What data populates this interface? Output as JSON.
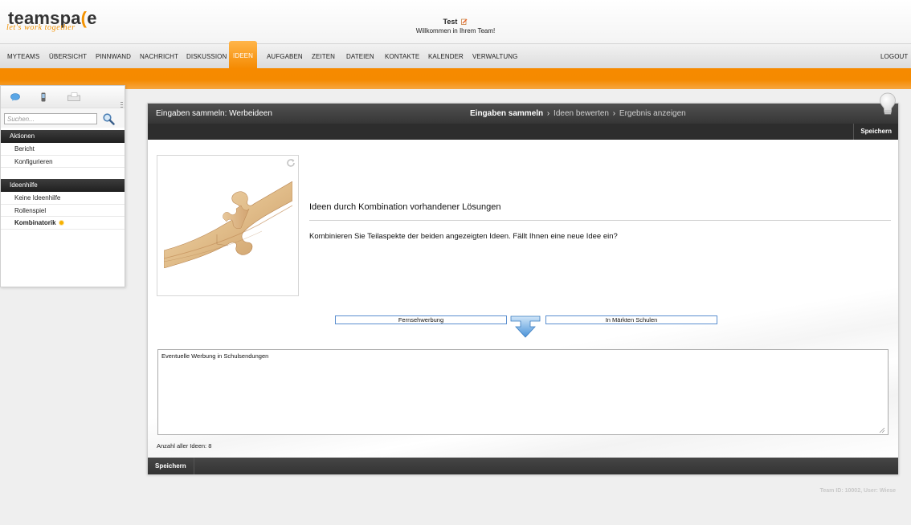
{
  "brand": {
    "name_prefix": "teamspa",
    "name_suffix": "e",
    "tagline": "let's work together",
    "accent_color": "#f58a00"
  },
  "greeting": {
    "user": "Test",
    "message": "Willkommen in Ihrem Team!"
  },
  "nav": {
    "items": [
      "MYTEAMS",
      "ÜBERSICHT",
      "PINNWAND",
      "NACHRICHT",
      "DISKUSSION",
      "IDEEN",
      "AUFGABEN",
      "ZEITEN",
      "DATEIEN",
      "KONTAKTE",
      "KALENDER",
      "VERWALTUNG"
    ],
    "active": "IDEEN",
    "logout": "LOGOUT"
  },
  "sidebar": {
    "search_placeholder": "Suchen...",
    "sections": [
      {
        "title": "Aktionen",
        "items": [
          {
            "label": "Bericht"
          },
          {
            "label": "Konfigurieren"
          }
        ]
      },
      {
        "title": "Ideenhilfe",
        "items": [
          {
            "label": "Keine Ideenhilfe"
          },
          {
            "label": "Rollenspiel"
          },
          {
            "label": "Kombinatorik",
            "active": true
          }
        ]
      }
    ]
  },
  "panel": {
    "title": "Eingaben sammeln: Werbeideen",
    "steps": [
      "Eingaben sammeln",
      "Ideen bewerten",
      "Ergebnis anzeigen"
    ],
    "current_step": "Eingaben sammeln",
    "save_label": "Speichern",
    "idea_title": "Ideen durch Kombination vorhandener Lösungen",
    "idea_description": "Kombinieren Sie Teilaspekte der beiden angezeigten Ideen. Fällt Ihnen eine neue Idee ein?",
    "combo_left": "Fernsehwerbung",
    "combo_right": "In Märkten Schulen",
    "textarea_value": "Eventuelle Werbung in Schulsendungen",
    "count_label": "Anzahl aller Ideen: 8"
  },
  "footer": {
    "info": "Team ID: 10002, User: Wiese"
  }
}
